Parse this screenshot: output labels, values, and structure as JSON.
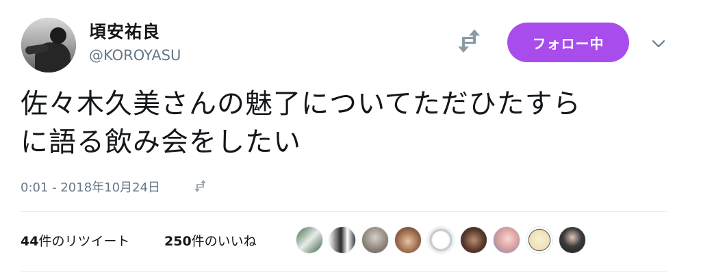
{
  "user": {
    "name": "頃安祐良",
    "handle": "@KOROYASU"
  },
  "follow_button": {
    "label": "フォロー中",
    "color": "#a84dec"
  },
  "tweet": {
    "lines": [
      "佐々木久美さんの魅了についてただひたすら",
      "に語る飲み会をしたい"
    ]
  },
  "meta": {
    "timestamp": "0:01 - 2018年10月24日"
  },
  "stats": {
    "retweets_count": "44",
    "retweets_label": "件のリツイート",
    "likes_count": "250",
    "likes_label": "件のいいね"
  },
  "likers": [
    {
      "icon": "avatar-1"
    },
    {
      "icon": "avatar-2"
    },
    {
      "icon": "avatar-3"
    },
    {
      "icon": "avatar-4"
    },
    {
      "icon": "avatar-5"
    },
    {
      "icon": "avatar-6"
    },
    {
      "icon": "avatar-7"
    },
    {
      "icon": "avatar-8"
    },
    {
      "icon": "avatar-9"
    }
  ]
}
